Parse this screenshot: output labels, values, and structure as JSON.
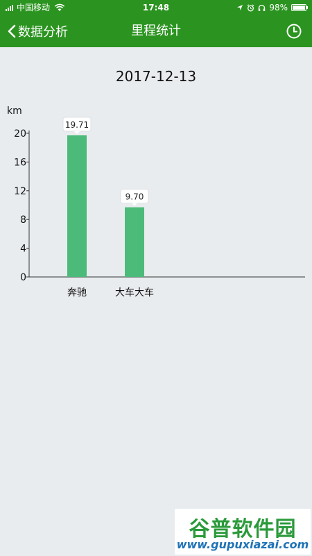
{
  "status_bar": {
    "carrier": "中国移动",
    "time": "17:48",
    "battery": "98%",
    "battery_level": 0.98
  },
  "nav": {
    "back_label": "数据分析",
    "title": "里程统计",
    "back_icon": "chevron-left-icon",
    "history_icon": "clock-icon"
  },
  "date_title": "2017-12-13",
  "colors": {
    "header": "#2b9420",
    "bar": "#4cbb7a",
    "background": "#e9ecef"
  },
  "chart_data": {
    "type": "bar",
    "ylabel": "km",
    "categories": [
      "奔驰",
      "大车大车"
    ],
    "values": [
      19.71,
      9.7
    ],
    "value_labels": [
      "19.71",
      "9.70"
    ],
    "yticks": [
      0,
      4,
      8,
      12,
      16,
      20
    ],
    "ylim": [
      0,
      20
    ],
    "grid": false
  },
  "watermark": {
    "main": "谷普软件园",
    "url": "www.gupuxiazai.com"
  }
}
